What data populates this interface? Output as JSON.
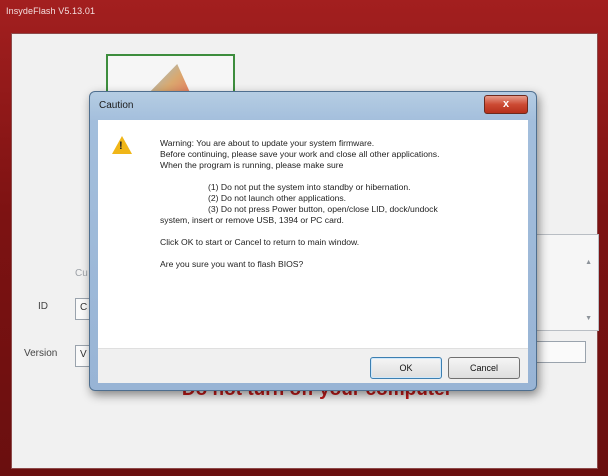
{
  "main": {
    "title": "InsydeFlash V5.13.01",
    "current_label_fragment": "Cu",
    "id_label": "ID",
    "id_value_fragment": "C",
    "version_label": "Version",
    "version_value_fragment": "V",
    "warning_text": "Do not turn off your computer"
  },
  "dialog": {
    "title": "Caution",
    "close_glyph": "x",
    "icon": "warning-icon",
    "lines": [
      "Warning: You are about to update your system firmware.",
      "Before continuing, please save your work and close all other applications.",
      "When the program is running, please make sure"
    ],
    "rules": [
      "(1) Do not put the system into standby or hibernation.",
      "(2) Do not launch other applications.",
      "(3) Do not press Power button, open/close LID, dock/undock"
    ],
    "rules_tail": "system, insert or remove USB, 1394 or PC card.",
    "instruction": "Click OK to start or Cancel to return to main window.",
    "question": "Are you sure you want to flash BIOS?",
    "ok_label": "OK",
    "cancel_label": "Cancel"
  }
}
